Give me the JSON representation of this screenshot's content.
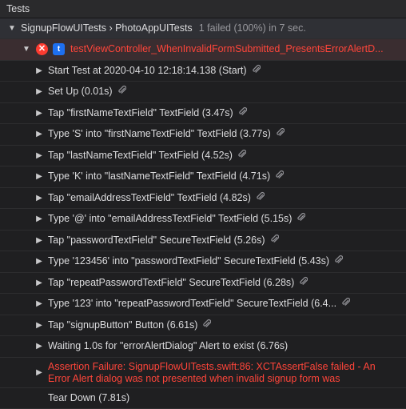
{
  "header": {
    "title": "Tests"
  },
  "suite": {
    "name": "SignupFlowUITests › PhotoAppUITests",
    "result": "1 failed (100%) in 7 sec."
  },
  "test": {
    "name": "testViewController_WhenInvalidFormSubmitted_PresentsErrorAlertD...",
    "error_icon_text": "✕",
    "type_icon_text": "t"
  },
  "steps": [
    {
      "label": "Start Test at 2020-04-10 12:18:14.138 (Start)",
      "attachment": true
    },
    {
      "label": "Set Up (0.01s)",
      "attachment": true
    },
    {
      "label": "Tap \"firstNameTextField\" TextField (3.47s)",
      "attachment": true
    },
    {
      "label": "Type 'S' into \"firstNameTextField\" TextField (3.77s)",
      "attachment": true
    },
    {
      "label": "Tap \"lastNameTextField\" TextField (4.52s)",
      "attachment": true
    },
    {
      "label": "Type 'K' into \"lastNameTextField\" TextField (4.71s)",
      "attachment": true
    },
    {
      "label": "Tap \"emailAddressTextField\" TextField (4.82s)",
      "attachment": true
    },
    {
      "label": "Type '@' into \"emailAddressTextField\" TextField (5.15s)",
      "attachment": true
    },
    {
      "label": "Tap \"passwordTextField\" SecureTextField (5.26s)",
      "attachment": true
    },
    {
      "label": "Type '123456' into \"passwordTextField\" SecureTextField (5.43s)",
      "attachment": true
    },
    {
      "label": "Tap \"repeatPasswordTextField\" SecureTextField (6.28s)",
      "attachment": true
    },
    {
      "label": "Type '123' into \"repeatPasswordTextField\" SecureTextField (6.4...",
      "attachment": true
    },
    {
      "label": "Tap \"signupButton\" Button (6.61s)",
      "attachment": true
    },
    {
      "label": "Waiting 1.0s for \"errorAlertDialog\" Alert to exist (6.76s)",
      "attachment": false
    }
  ],
  "failure": {
    "text": "Assertion Failure: SignupFlowUITests.swift:86: XCTAssertFalse failed - An Error Alert dialog was not presented when invalid signup form was"
  },
  "teardown": {
    "label": "Tear Down (7.81s)"
  },
  "icons": {
    "disclosure_open": "▼",
    "disclosure_closed": "▶",
    "attachment": "paperclip-icon"
  },
  "colors": {
    "failure_red": "#ff453a",
    "error_badge": "#ff3b30",
    "type_badge": "#1e6ff0"
  }
}
